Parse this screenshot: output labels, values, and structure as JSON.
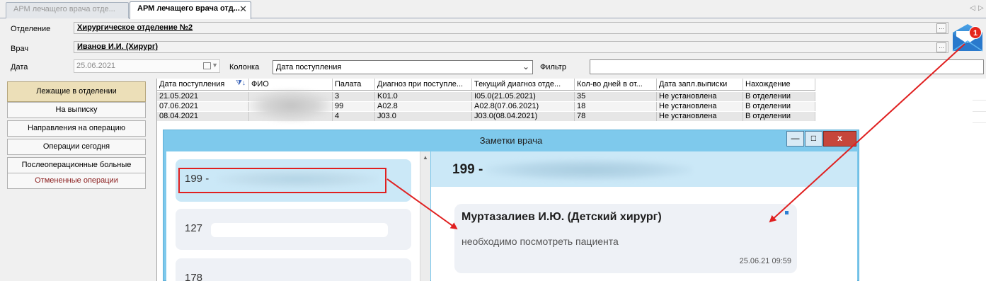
{
  "tabs": [
    {
      "label": "АРМ лечащего врача отде...",
      "active": false
    },
    {
      "label": "АРМ лечащего врача отд...",
      "active": true
    }
  ],
  "tab_close": "✕",
  "tab_nav": {
    "prev": "◁",
    "next": "▷"
  },
  "form": {
    "department_label": "Отделение",
    "department_value": "Хирургическое отделение №2",
    "doctor_label": "Врач",
    "doctor_value": "Иванов И.И. (Хирург)",
    "date_label": "Дата",
    "date_value": "25.06.2021",
    "column_label": "Колонка",
    "column_value": "Дата поступления",
    "filter_label": "Фильтр",
    "filter_value": "",
    "ellipsis": "..."
  },
  "notification": {
    "count": "1",
    "icon": "envelope-icon",
    "badge_color": "#e5251c"
  },
  "nav": [
    {
      "label": "Лежащие в отделении",
      "selected": true
    },
    {
      "label": "На выписку"
    },
    {
      "label": "Направления на операцию"
    },
    {
      "label": "Операции сегодня"
    },
    {
      "label": "Послеоперационные больные"
    },
    {
      "label": "Отмененные операции",
      "cancelled": true
    }
  ],
  "grid": {
    "columns": [
      "Дата поступления",
      "ФИО",
      "Палата",
      "Диагноз при поступле...",
      "Текущий диагноз отде...",
      "Кол-во дней в от...",
      "Дата запл.выписки",
      "Нахождение"
    ],
    "rows": [
      [
        "21.05.2021",
        "",
        "3",
        "K01.0",
        "I05.0(21.05.2021)",
        "35",
        "Не установлена",
        "В отделении"
      ],
      [
        "07.06.2021",
        "",
        "99",
        "A02.8",
        "A02.8(07.06.2021)",
        "18",
        "Не установлена",
        "В отделении"
      ],
      [
        "08.04.2021",
        "",
        "4",
        "J03.0",
        "J03.0(08.04.2021)",
        "78",
        "Не установлена",
        "В отделении"
      ]
    ]
  },
  "dialog": {
    "title": "Заметки врача",
    "minimize": "—",
    "maximize": "□",
    "close": "x",
    "cards": [
      {
        "label": "199 -",
        "selected": true
      },
      {
        "label": "127"
      },
      {
        "label": "178"
      }
    ],
    "conversation_header": "199 -",
    "message": {
      "author": "Муртазалиев И.Ю. (Детский хирург)",
      "text": "необходимо посмотреть пациента",
      "time": "25.06.21 09:59"
    }
  },
  "annotation_color": "#e02020"
}
